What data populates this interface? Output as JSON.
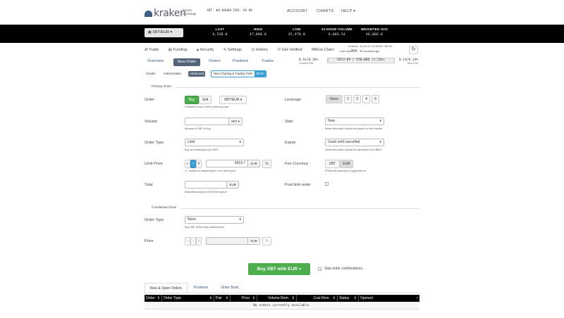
{
  "header": {
    "logo_text": "kraken",
    "logo_sub1": "bitcoin",
    "logo_sub2": "exchange",
    "balances": "XBT: ฿0.00000   EUR: €0.00",
    "nav": {
      "account": "ACCOUNT",
      "charts": "CHARTS",
      "help": "HELP ▾"
    }
  },
  "ticker": {
    "pair": "XBT/EUR ▾",
    "items": [
      {
        "label": "LAST",
        "value": "6,538.0"
      },
      {
        "label": "HIGH",
        "value": "47,060.0"
      },
      {
        "label": "LOW",
        "value": "45,470.0"
      },
      {
        "label": "24 HOUR VOLUME",
        "value": "6,003.54"
      },
      {
        "label": "WEIGHTED AVG",
        "value": "46,066.0"
      }
    ]
  },
  "subnav": {
    "items": [
      "Trade",
      "Funding",
      "Security",
      "Settings",
      "History",
      "Get Verified",
      "MtGox Claim"
    ]
  },
  "status": {
    "current_time_label": "Current time:",
    "current_time": "11-04-17 12:49:03 +00:00",
    "last_updated_label": "Last Updated:",
    "last_updated": "35 seconds ago"
  },
  "tabs": {
    "overview": "Overview",
    "new_order": "New Order",
    "orders": "Orders",
    "positions": "Positions",
    "trades": "Trades"
  },
  "modes": {
    "simple": "Simple",
    "intermediate": "Intermediate",
    "advanced": "Advanced",
    "new_charting": "New Charting & Trading Tools",
    "beta": "BETA"
  },
  "fees": {
    "current": "0.16/0.26%",
    "current_label": "Current Fee",
    "progress": "€613.89 / €50,000 (1.22%)",
    "progress_fraction": 0.0122,
    "next": "0.14/0.24%",
    "next_label": "Next Fee"
  },
  "primary": {
    "title": "Primary Order",
    "order_label": "Order",
    "buy": "Buy",
    "sell": "Sell",
    "pair_select": "XBT/EUR ▾",
    "order_help": "Choose to buy or sell a currency pair.",
    "volume_label": "Volume",
    "volume_suffix": "XBT ▾",
    "volume_help": "Amount of XBT to buy.",
    "order_type_label": "Order Type",
    "order_type_value": "Limit",
    "order_type_help": "Buy at a fixed price per XBT.",
    "limit_price_label": "Limit Price",
    "limit_price_value": "6919.7",
    "limit_price_suffix": "EUR",
    "limit_price_help": "+/- relative to market price, # for fixed price.",
    "total_label": "Total",
    "total_suffix": "EUR",
    "total_help": "Estimated amount of EUR to spend.",
    "leverage_label": "Leverage",
    "leverage_options": [
      "None",
      "2",
      "3",
      "4",
      "5"
    ],
    "start_label": "Start",
    "start_value": "Now",
    "start_help": "When this order should be placed on the market.",
    "expire_label": "Expire",
    "expire_value": "Good until cancelled",
    "expire_help": "When this order should be cancelled if not filled.",
    "fee_currency_label": "Fee Currency",
    "fee_currency_options": [
      "XBT",
      "EUR"
    ],
    "fee_currency_help": "Preferred currency to apply fees to.",
    "post_limit_label": "Post limit order"
  },
  "conditional": {
    "title": "Conditional Close",
    "order_type_label": "Order Type",
    "order_type_value": "None",
    "order_type_help": "Buy XBT at the best market price.",
    "price_label": "Price",
    "price_suffix": "EUR"
  },
  "submit": {
    "label": "Buy XBT with EUR »",
    "skip_label": "Skip order confirmations."
  },
  "bottom_tabs": [
    "New & Open Orders",
    "Positions",
    "Order Book"
  ],
  "table": {
    "columns": [
      "Order",
      "Order Type",
      "Pair",
      "Price",
      "Volume Rem.",
      "Cost Rem.",
      "Status",
      "Opened"
    ],
    "empty": "No orders currently available."
  }
}
